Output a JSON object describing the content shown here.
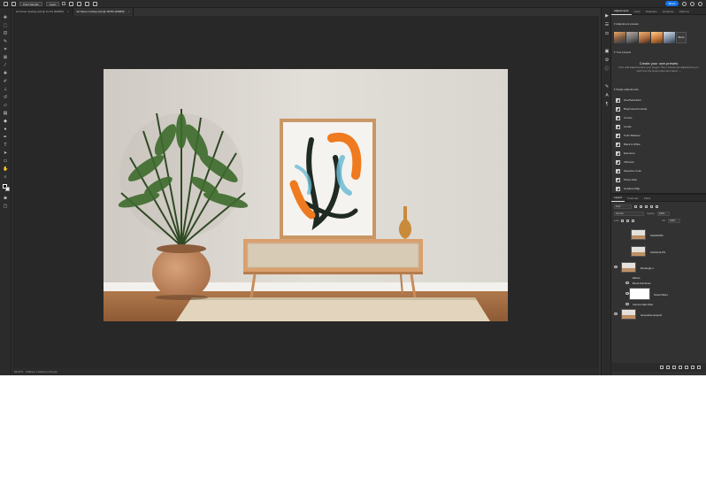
{
  "topbar": {
    "sample_label": "Point Sample",
    "layer_select": "Layer",
    "auto_select_label": "",
    "share_label": "Share"
  },
  "tabs": [
    {
      "label": "art frame mockup.psd @ 11.4% (RGB/8)",
      "close": "×"
    },
    {
      "label": "art frame mockup.psd @ 18.5% (RGB/8)",
      "close": "×"
    }
  ],
  "status": {
    "zoom": "36.67%",
    "size": "1536 px x 1024 px (72 ppi)"
  },
  "adjustments_panel": {
    "tabs": [
      "Adjustments",
      "Color",
      "Swatches",
      "Gradients",
      "Patterns"
    ],
    "presets_heading": "Adjustment presets",
    "more_label": "More",
    "your_presets_heading": "Your presets",
    "your_presets_title": "Create your own presets",
    "your_presets_desc": "First, add adjustments to your project. Then, choose the adjustments you want from the layers panel and select ⋯",
    "single_heading": "Single adjustments",
    "items": [
      "Hue/Saturation",
      "Brightness/Contrast",
      "Curves",
      "Levels",
      "Color Balance",
      "Black & White",
      "Exposure",
      "Vibrance",
      "Selective Color",
      "Photo Filter",
      "Gradient Map"
    ]
  },
  "layers_panel": {
    "tabs": [
      "Layers",
      "Channels",
      "Paths"
    ],
    "filter_kind": "Kind",
    "blend_mode": "Normal",
    "opacity_label": "Opacity",
    "opacity_value": "100%",
    "lock_label": "Lock",
    "fill_label": "Fill",
    "fill_value": "100%",
    "layers": [
      {
        "name": "SHADOWS",
        "thumb": "photo"
      },
      {
        "name": "HIGHLIGHTS",
        "thumb": "photo"
      },
      {
        "name": "Rectangle 1",
        "thumb": "photo"
      },
      {
        "name": "Effects",
        "thumb": "none"
      },
      {
        "name": "Bevel & Emboss",
        "thumb": "none"
      },
      {
        "name": "Smart Filters",
        "thumb": "white"
      },
      {
        "name": "Camera Raw Filter",
        "thumb": "none"
      },
      {
        "name": "Generative Expand",
        "thumb": "photo"
      }
    ]
  }
}
